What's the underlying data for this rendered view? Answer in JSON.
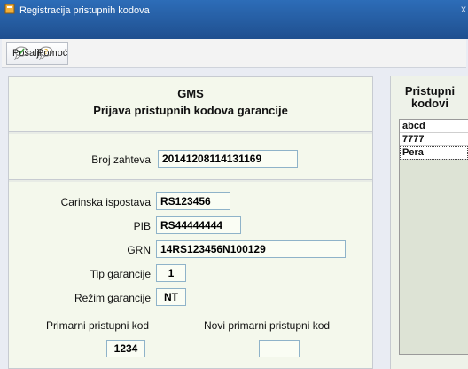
{
  "window": {
    "title": "Registracija pristupnih kodova",
    "close_label": "x"
  },
  "toolbar": {
    "send_label": "Pošalji",
    "help_label": "Pomoć"
  },
  "form": {
    "heading": "GMS",
    "subheading": "Prijava pristupnih kodova garancije",
    "request_number_label": "Broj zahteva",
    "request_number_value": "20141208114131169",
    "customs_office_label": "Carinska ispostava",
    "customs_office_value": "RS123456",
    "pib_label": "PIB",
    "pib_value": "RS44444444",
    "grn_label": "GRN",
    "grn_value": "14RS123456N100129",
    "guarantee_type_label": "Tip garancije",
    "guarantee_type_value": "1",
    "guarantee_regime_label": "Režim garancije",
    "guarantee_regime_value": "NT",
    "primary_code_label": "Primarni pristupni kod",
    "primary_code_value": "1234",
    "new_primary_code_label": "Novi primarni pristupni kod",
    "new_primary_code_value": ""
  },
  "access_codes": {
    "title_line1": "Pristupni",
    "title_line2": "kodovi",
    "items": [
      "abcd",
      "7777",
      "Pera"
    ],
    "selected_index": 2
  },
  "colors": {
    "titlebar": "#2d6db8",
    "form_bg": "#f4f8ec",
    "field_border": "#8fb3c9"
  }
}
